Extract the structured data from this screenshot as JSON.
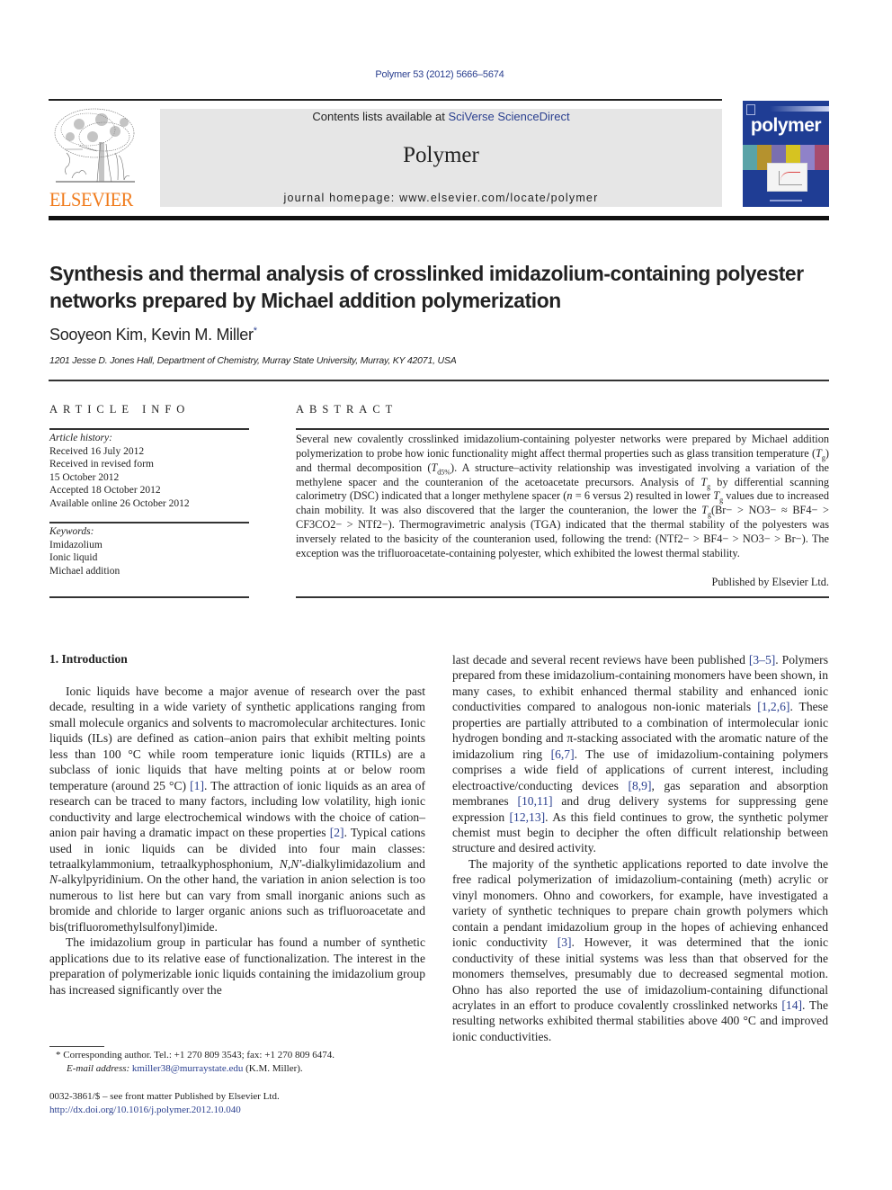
{
  "journal_ref": "Polymer 53 (2012) 5666–5674",
  "header": {
    "contents_prefix": "Contents lists available at ",
    "contents_link": "SciVerse ScienceDirect",
    "journal_title": "Polymer",
    "homepage": "journal homepage: www.elsevier.com/locate/polymer",
    "publisher_logo_text": "ELSEVIER",
    "cover_title": "polymer",
    "brand_orange": "#f07b1c",
    "cover_blue": "#1f3d94",
    "link_color": "#2a3f8f"
  },
  "article": {
    "title": "Synthesis and thermal analysis of crosslinked imidazolium-containing polyester networks prepared by Michael addition polymerization",
    "authors": "Sooyeon Kim, Kevin M. Miller",
    "author_mark": "*",
    "affiliation": "1201 Jesse D. Jones Hall, Department of Chemistry, Murray State University, Murray, KY 42071, USA"
  },
  "article_info": {
    "heading": "ARTICLE INFO",
    "history_label": "Article history:",
    "history": [
      "Received 16 July 2012",
      "Received in revised form",
      "15 October 2012",
      "Accepted 18 October 2012",
      "Available online 26 October 2012"
    ],
    "keywords_label": "Keywords:",
    "keywords": [
      "Imidazolium",
      "Ionic liquid",
      "Michael addition"
    ]
  },
  "abstract": {
    "heading": "ABSTRACT",
    "s1": "Several new covalently crosslinked imidazolium-containing polyester networks were prepared by Michael addition polymerization to probe how ionic functionality might affect thermal properties such as glass transition temperature (",
    "s2": ") and thermal decomposition (",
    "s3": "). A structure–activity relationship was investigated involving a variation of the methylene spacer and the counteranion of the acetoacetate precursors. Analysis of ",
    "s4": " by differential scanning calorimetry (DSC) indicated that a longer methylene spacer (",
    "s5": " = 6 versus 2) resulted in lower ",
    "s6": " values due to increased chain mobility. It was also discovered that the larger the counteranion, the lower the ",
    "s7": "(Br− > NO3− ≈ BF4− > CF3CO2− > NTf2−). Thermogravimetric analysis (TGA) indicated that the thermal stability of the polyesters was inversely related to the basicity of the counteranion used, following the trend: (NTf2− > BF4− > NO3− > Br−). The exception was the trifluoroacetate-containing polyester, which exhibited the lowest thermal stability.",
    "tg_T": "T",
    "tg_sub": "g",
    "td_sub": "d5%",
    "n_var": "n",
    "published": "Published by Elsevier Ltd."
  },
  "introduction": {
    "heading": "1.  Introduction",
    "left": {
      "p1a": "Ionic liquids have become a major avenue of research over the past decade, resulting in a wide variety of synthetic applications ranging from small molecule organics and solvents to macromolecular architectures. Ionic liquids (ILs) are defined as cation–anion pairs that exhibit melting points less than 100 °C while room temperature ionic liquids (RTILs) are a subclass of ionic liquids that have melting points at or below room temperature (around 25 °C) ",
      "ref1": "[1]",
      "p1b": ". The attraction of ionic liquids as an area of research can be traced to many factors, including low volatility, high ionic conductivity and large electrochemical windows with the choice of cation–anion pair having a dramatic impact on these properties ",
      "ref2": "[2]",
      "p1c": ". Typical cations used in ionic liquids can be divided into four main classes: tetraalkylammonium, tetraalkyphosphonium, ",
      "nn": "N,N′",
      "p1d": "-dialkylimidazolium and ",
      "n": "N",
      "p1e": "-alkylpyridinium. On the other hand, the variation in anion selection is too numerous to list here but can vary from small inorganic anions such as bromide and chloride to larger organic anions such as trifluoroacetate and bis(trifluoromethylsulfonyl)imide.",
      "p2": "The imidazolium group in particular has found a number of synthetic applications due to its relative ease of functionalization. The interest in the preparation of polymerizable ionic liquids containing the imidazolium group has increased significantly over the"
    },
    "right": {
      "p1a": "last decade and several recent reviews have been published ",
      "ref35": "[3–5]",
      "p1b": ". Polymers prepared from these imidazolium-containing monomers have been shown, in many cases, to exhibit enhanced thermal stability and enhanced ionic conductivities compared to analogous non-ionic materials ",
      "ref126": "[1,2,6]",
      "p1c": ". These properties are partially attributed to a combination of intermolecular ionic hydrogen bonding and π-stacking associated with the aromatic nature of the imidazolium ring ",
      "ref67": "[6,7]",
      "p1d": ". The use of imidazolium-containing polymers comprises a wide field of applications of current interest, including electroactive/conducting devices ",
      "ref89": "[8,9]",
      "p1e": ", gas separation and absorption membranes ",
      "ref1011": "[10,11]",
      "p1f": " and drug delivery systems for suppressing gene expression ",
      "ref1213": "[12,13]",
      "p1g": ". As this field continues to grow, the synthetic polymer chemist must begin to decipher the often difficult relationship between structure and desired activity.",
      "p2a": "The majority of the synthetic applications reported to date involve the free radical polymerization of imidazolium-containing (meth) acrylic or vinyl monomers. Ohno and coworkers, for example, have investigated a variety of synthetic techniques to prepare chain growth polymers which contain a pendant imidazolium group in the hopes of achieving enhanced ionic conductivity ",
      "ref3": "[3]",
      "p2b": ". However, it was determined that the ionic conductivity of these initial systems was less than that observed for the monomers themselves, presumably due to decreased segmental motion. Ohno has also reported the use of imidazolium-containing difunctional acrylates in an effort to produce covalently crosslinked networks ",
      "ref14": "[14]",
      "p2c": ". The resulting networks exhibited thermal stabilities above 400 °C and improved ionic conductivities."
    }
  },
  "footnote": {
    "mark": "*",
    "text": " Corresponding author. Tel.: +1 270 809 3543; fax: +1 270 809 6474.",
    "email_label": "E-mail address:",
    "email": "kmiller38@murraystate.edu",
    "email_suffix": " (K.M. Miller)."
  },
  "front_matter": {
    "issn_line": "0032-3861/$ – see front matter Published by Elsevier Ltd.",
    "doi": "http://dx.doi.org/10.1016/j.polymer.2012.10.040"
  }
}
